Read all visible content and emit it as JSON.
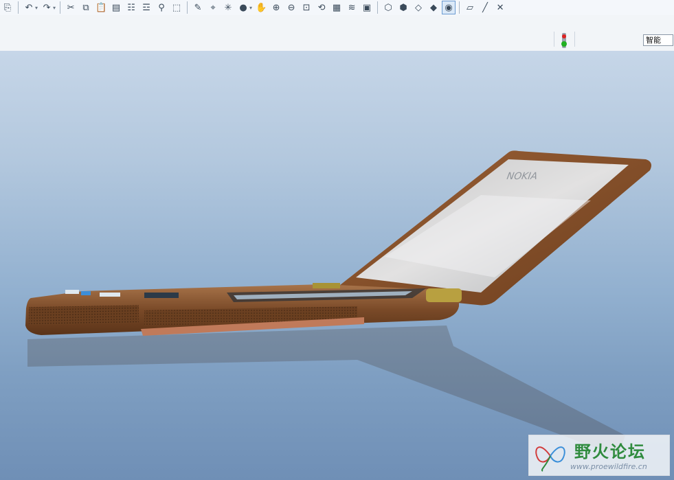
{
  "toolbar": {
    "buttons": [
      {
        "name": "regenerate-icon",
        "glyph": "⎘"
      },
      {
        "name": "undo-icon",
        "glyph": "↶"
      },
      {
        "name": "redo-icon",
        "glyph": "↷"
      },
      {
        "name": "cut-icon",
        "glyph": "✂"
      },
      {
        "name": "copy-icon",
        "glyph": "⧉"
      },
      {
        "name": "paste-icon",
        "glyph": "📋"
      },
      {
        "name": "paste-special-icon",
        "glyph": "▤"
      },
      {
        "name": "regen-list-icon",
        "glyph": "☷"
      },
      {
        "name": "model-tree-icon",
        "glyph": "☲"
      },
      {
        "name": "find-icon",
        "glyph": "⚲"
      },
      {
        "name": "select-box-icon",
        "glyph": "⬚"
      },
      {
        "name": "sketch-icon",
        "glyph": "✎"
      },
      {
        "name": "datum-icon",
        "glyph": "⌖"
      },
      {
        "name": "spin-center-icon",
        "glyph": "✳"
      },
      {
        "name": "shading-ball-icon",
        "glyph": "●"
      },
      {
        "name": "pan-icon",
        "glyph": "✋"
      },
      {
        "name": "zoom-in-icon",
        "glyph": "⊕"
      },
      {
        "name": "zoom-out-icon",
        "glyph": "⊖"
      },
      {
        "name": "refit-icon",
        "glyph": "⊡"
      },
      {
        "name": "reorient-icon",
        "glyph": "⟲"
      },
      {
        "name": "saved-views-icon",
        "glyph": "▦"
      },
      {
        "name": "layers-icon",
        "glyph": "≋"
      },
      {
        "name": "view-manager-icon",
        "glyph": "▣"
      },
      {
        "name": "wireframe-icon",
        "glyph": "⬡"
      },
      {
        "name": "hidden-line-icon",
        "glyph": "⬢"
      },
      {
        "name": "no-hidden-icon",
        "glyph": "◇"
      },
      {
        "name": "shading-icon",
        "glyph": "◆"
      },
      {
        "name": "enhanced-realism-icon",
        "glyph": "◉"
      },
      {
        "name": "datum-planes-icon",
        "glyph": "▱"
      },
      {
        "name": "datum-axes-icon",
        "glyph": "╱"
      },
      {
        "name": "datum-points-icon",
        "glyph": "✕"
      }
    ],
    "active_button": "enhanced-realism-icon"
  },
  "status": {
    "filter_value": "智能"
  },
  "model": {
    "logo_text": "NOKIA",
    "body_color": "#8a5530",
    "screen_color": "#d7dade"
  },
  "watermark": {
    "title": "野火论坛",
    "url": "www.proewildfire.cn"
  }
}
